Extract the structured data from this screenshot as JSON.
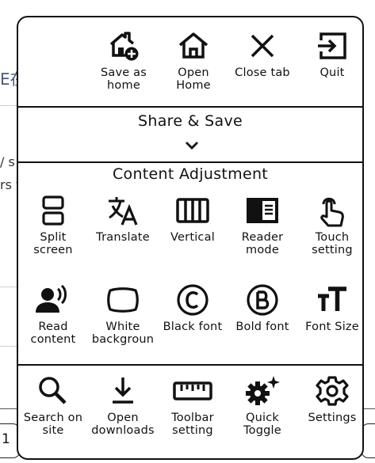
{
  "background": {
    "fragment_1": "E在",
    "fragment_2": "/ s",
    "fragment_3": "rs t",
    "fragment_4": "1"
  },
  "top_row": [
    {
      "label": "Save as\nhome",
      "icon": "home-add-icon"
    },
    {
      "label": "Open\nHome",
      "icon": "home-icon"
    },
    {
      "label": "Close tab",
      "icon": "close-icon"
    },
    {
      "label": "Quit",
      "icon": "exit-icon"
    }
  ],
  "share_save": {
    "title": "Share & Save",
    "icon": "chevron-down-icon"
  },
  "content_adjustment": {
    "title": "Content Adjustment",
    "row1": [
      {
        "label": "Split\nscreen",
        "icon": "split-screen-icon"
      },
      {
        "label": "Translate",
        "icon": "translate-icon"
      },
      {
        "label": "Vertical",
        "icon": "vertical-icon"
      },
      {
        "label": "Reader\nmode",
        "icon": "reader-mode-icon"
      },
      {
        "label": "Touch\nsetting",
        "icon": "touch-icon"
      }
    ],
    "row2": [
      {
        "label": "Read\ncontent",
        "icon": "speak-icon"
      },
      {
        "label": "White\nbackgroun",
        "icon": "white-background-icon"
      },
      {
        "label": "Black font",
        "icon": "black-font-icon"
      },
      {
        "label": "Bold font",
        "icon": "bold-font-icon"
      },
      {
        "label": "Font Size",
        "icon": "font-size-icon"
      }
    ]
  },
  "bottom_row": [
    {
      "label": "Search on\nsite",
      "icon": "search-icon"
    },
    {
      "label": "Open\ndownloads",
      "icon": "download-icon"
    },
    {
      "label": "Toolbar\nsetting",
      "icon": "ruler-icon"
    },
    {
      "label": "Quick\nToggle",
      "icon": "gear-sparkle-icon"
    },
    {
      "label": "Settings",
      "icon": "settings-icon"
    }
  ]
}
